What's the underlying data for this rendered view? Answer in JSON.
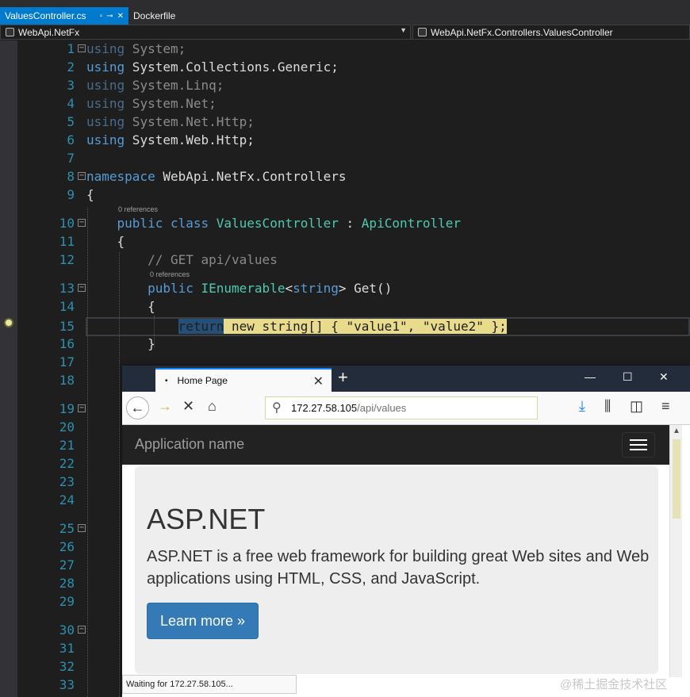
{
  "editor": {
    "tabs": [
      {
        "label": "ValuesController.cs",
        "active": true
      },
      {
        "label": "Dockerfile",
        "active": false
      }
    ],
    "project_dropdown": "WebApi.NetFx",
    "member_dropdown": "WebApi.NetFx.Controllers.ValuesController",
    "codelens": "0 references",
    "line_numbers": [
      "1",
      "2",
      "3",
      "4",
      "5",
      "6",
      "7",
      "8",
      "9",
      "10",
      "11",
      "12",
      "13",
      "14",
      "15",
      "16",
      "17",
      "18",
      "19",
      "20",
      "21",
      "22",
      "23",
      "24",
      "25",
      "26",
      "27",
      "28",
      "29",
      "30",
      "31",
      "32",
      "33"
    ],
    "code": {
      "l1a": "using",
      "l1b": " System;",
      "l2a": "using",
      "l2b": " System.Collections.Generic;",
      "l3a": "using",
      "l3b": " System.Linq;",
      "l4a": "using",
      "l4b": " System.Net;",
      "l5a": "using",
      "l5b": " System.Net.Http;",
      "l6a": "using",
      "l6b": " System.Web.Http;",
      "l8a": "namespace",
      "l8b": " WebApi.NetFx.Controllers",
      "l9": "{",
      "l10a": "public",
      "l10b": " class",
      "l10c": " ValuesController",
      "l10d": " : ",
      "l10e": "ApiController",
      "l11": "{",
      "l12": "// GET api/values",
      "l13a": "public",
      "l13b": " IEnumerable",
      "l13c": "<",
      "l13d": "string",
      "l13e": "> Get()",
      "l14": "{",
      "l15a": "return",
      "l15b": " new string[] { \"value1\", \"value2\" };",
      "l16": "}"
    }
  },
  "browser": {
    "tab_title": "Home Page",
    "new_tab": "+",
    "url_host": "172.27.58.105",
    "url_path": "/api/values",
    "app_name": "Application name",
    "heading": "ASP.NET",
    "lead": "ASP.NET is a free web framework for building great Web sites and Web applications using HTML, CSS, and JavaScript.",
    "learn_more": "Learn more »",
    "status": "Waiting for 172.27.58.105..."
  },
  "watermark": "@稀土掘金技术社区",
  "icons": [
    "back-icon",
    "forward-icon",
    "stop-icon",
    "home-icon",
    "search-icon",
    "download-icon",
    "library-icon",
    "sidebar-icon",
    "menu-icon",
    "close-icon",
    "minimize-icon",
    "maximize-icon",
    "breakpoint-icon",
    "hamburger-icon"
  ]
}
